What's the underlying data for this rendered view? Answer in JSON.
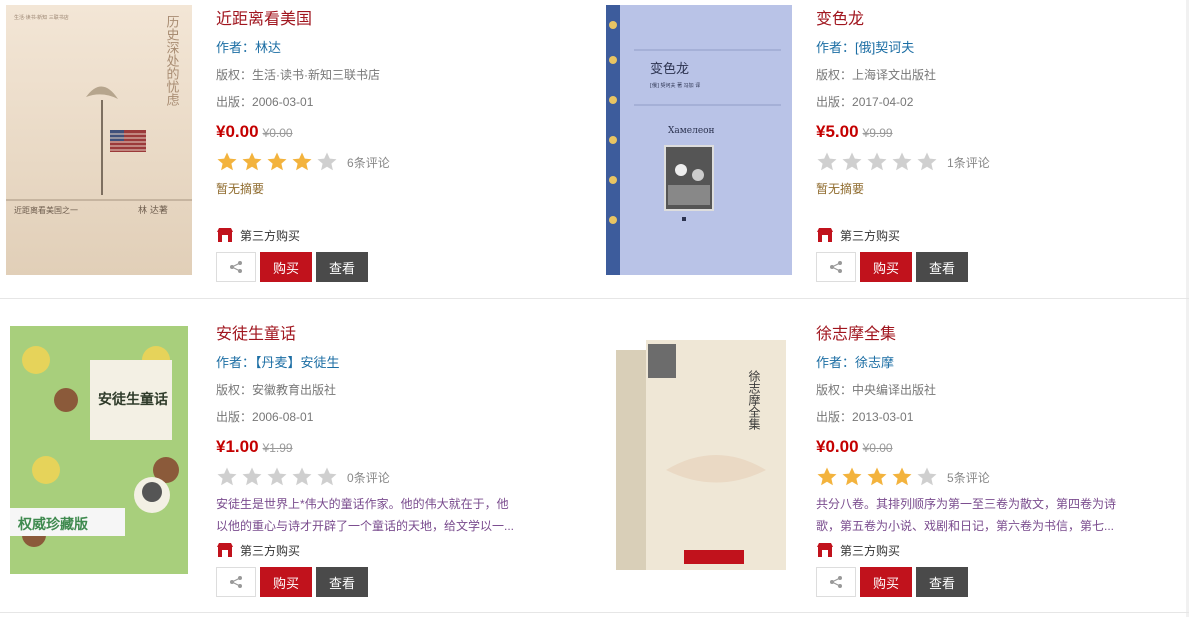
{
  "labels": {
    "author_prefix": "作者：",
    "publisher_prefix": "版权：",
    "date_prefix": "出版：",
    "reviews_suffix": "条评论",
    "third_party": "第三方购买",
    "buy": "购买",
    "view": "查看",
    "currency": "¥"
  },
  "books": [
    {
      "title": "近距离看美国",
      "author": "林达",
      "publisher": "生活·读书·新知三联书店",
      "date": "2006-03-01",
      "price": "0.00",
      "old_price": "0.00",
      "rating": 4,
      "reviews": "6",
      "summary": "暂无摘要",
      "cover": {
        "title": "历史深处的忧虑",
        "series": "近距离看美国之一",
        "author": "林 达著",
        "publisher_line": "生活·读书·新知 三联书店",
        "colors": [
          "#f1e3d2",
          "#d9c7ae"
        ]
      }
    },
    {
      "title": "变色龙",
      "author": "[俄]契诃夫",
      "publisher": "上海译文出版社",
      "date": "2017-04-02",
      "price": "5.00",
      "old_price": "9.99",
      "rating": 0,
      "reviews": "1",
      "summary": "暂无摘要",
      "cover": {
        "title": "变色龙",
        "subtitle": "Хамелеон",
        "author_line": "[俄] 契诃夫 著    冯加 译",
        "colors": [
          "#b7c2e6",
          "#3f5fa0"
        ]
      }
    },
    {
      "title": "安徒生童话",
      "author": "【丹麦】安徒生",
      "publisher": "安徽教育出版社",
      "date": "2006-08-01",
      "price": "1.00",
      "old_price": "1.99",
      "rating": 0,
      "reviews": "0",
      "summary_lines": [
        "安徒生是世界上*伟大的童话作家。他的伟大就在于，他",
        "以他的重心与诗才开辟了一个童话的天地，给文学以一..."
      ],
      "cover": {
        "title": "安徒生童话",
        "edition": "权威珍藏版",
        "colors": [
          "#a6d07a",
          "#ffffff"
        ]
      }
    },
    {
      "title": "徐志摩全集",
      "author": "徐志摩",
      "publisher": "中央编译出版社",
      "date": "2013-03-01",
      "price": "0.00",
      "old_price": "0.00",
      "rating": 4,
      "reviews": "5",
      "summary_lines": [
        "共分八卷。其排列顺序为第一至三卷为散文，第四卷为诗",
        "歌，第五卷为小说、戏剧和日记，第六卷为书信，第七..."
      ],
      "cover": {
        "title": "徐志摩全集",
        "colors": [
          "#efe7d6",
          "#bcaf93"
        ]
      }
    }
  ]
}
